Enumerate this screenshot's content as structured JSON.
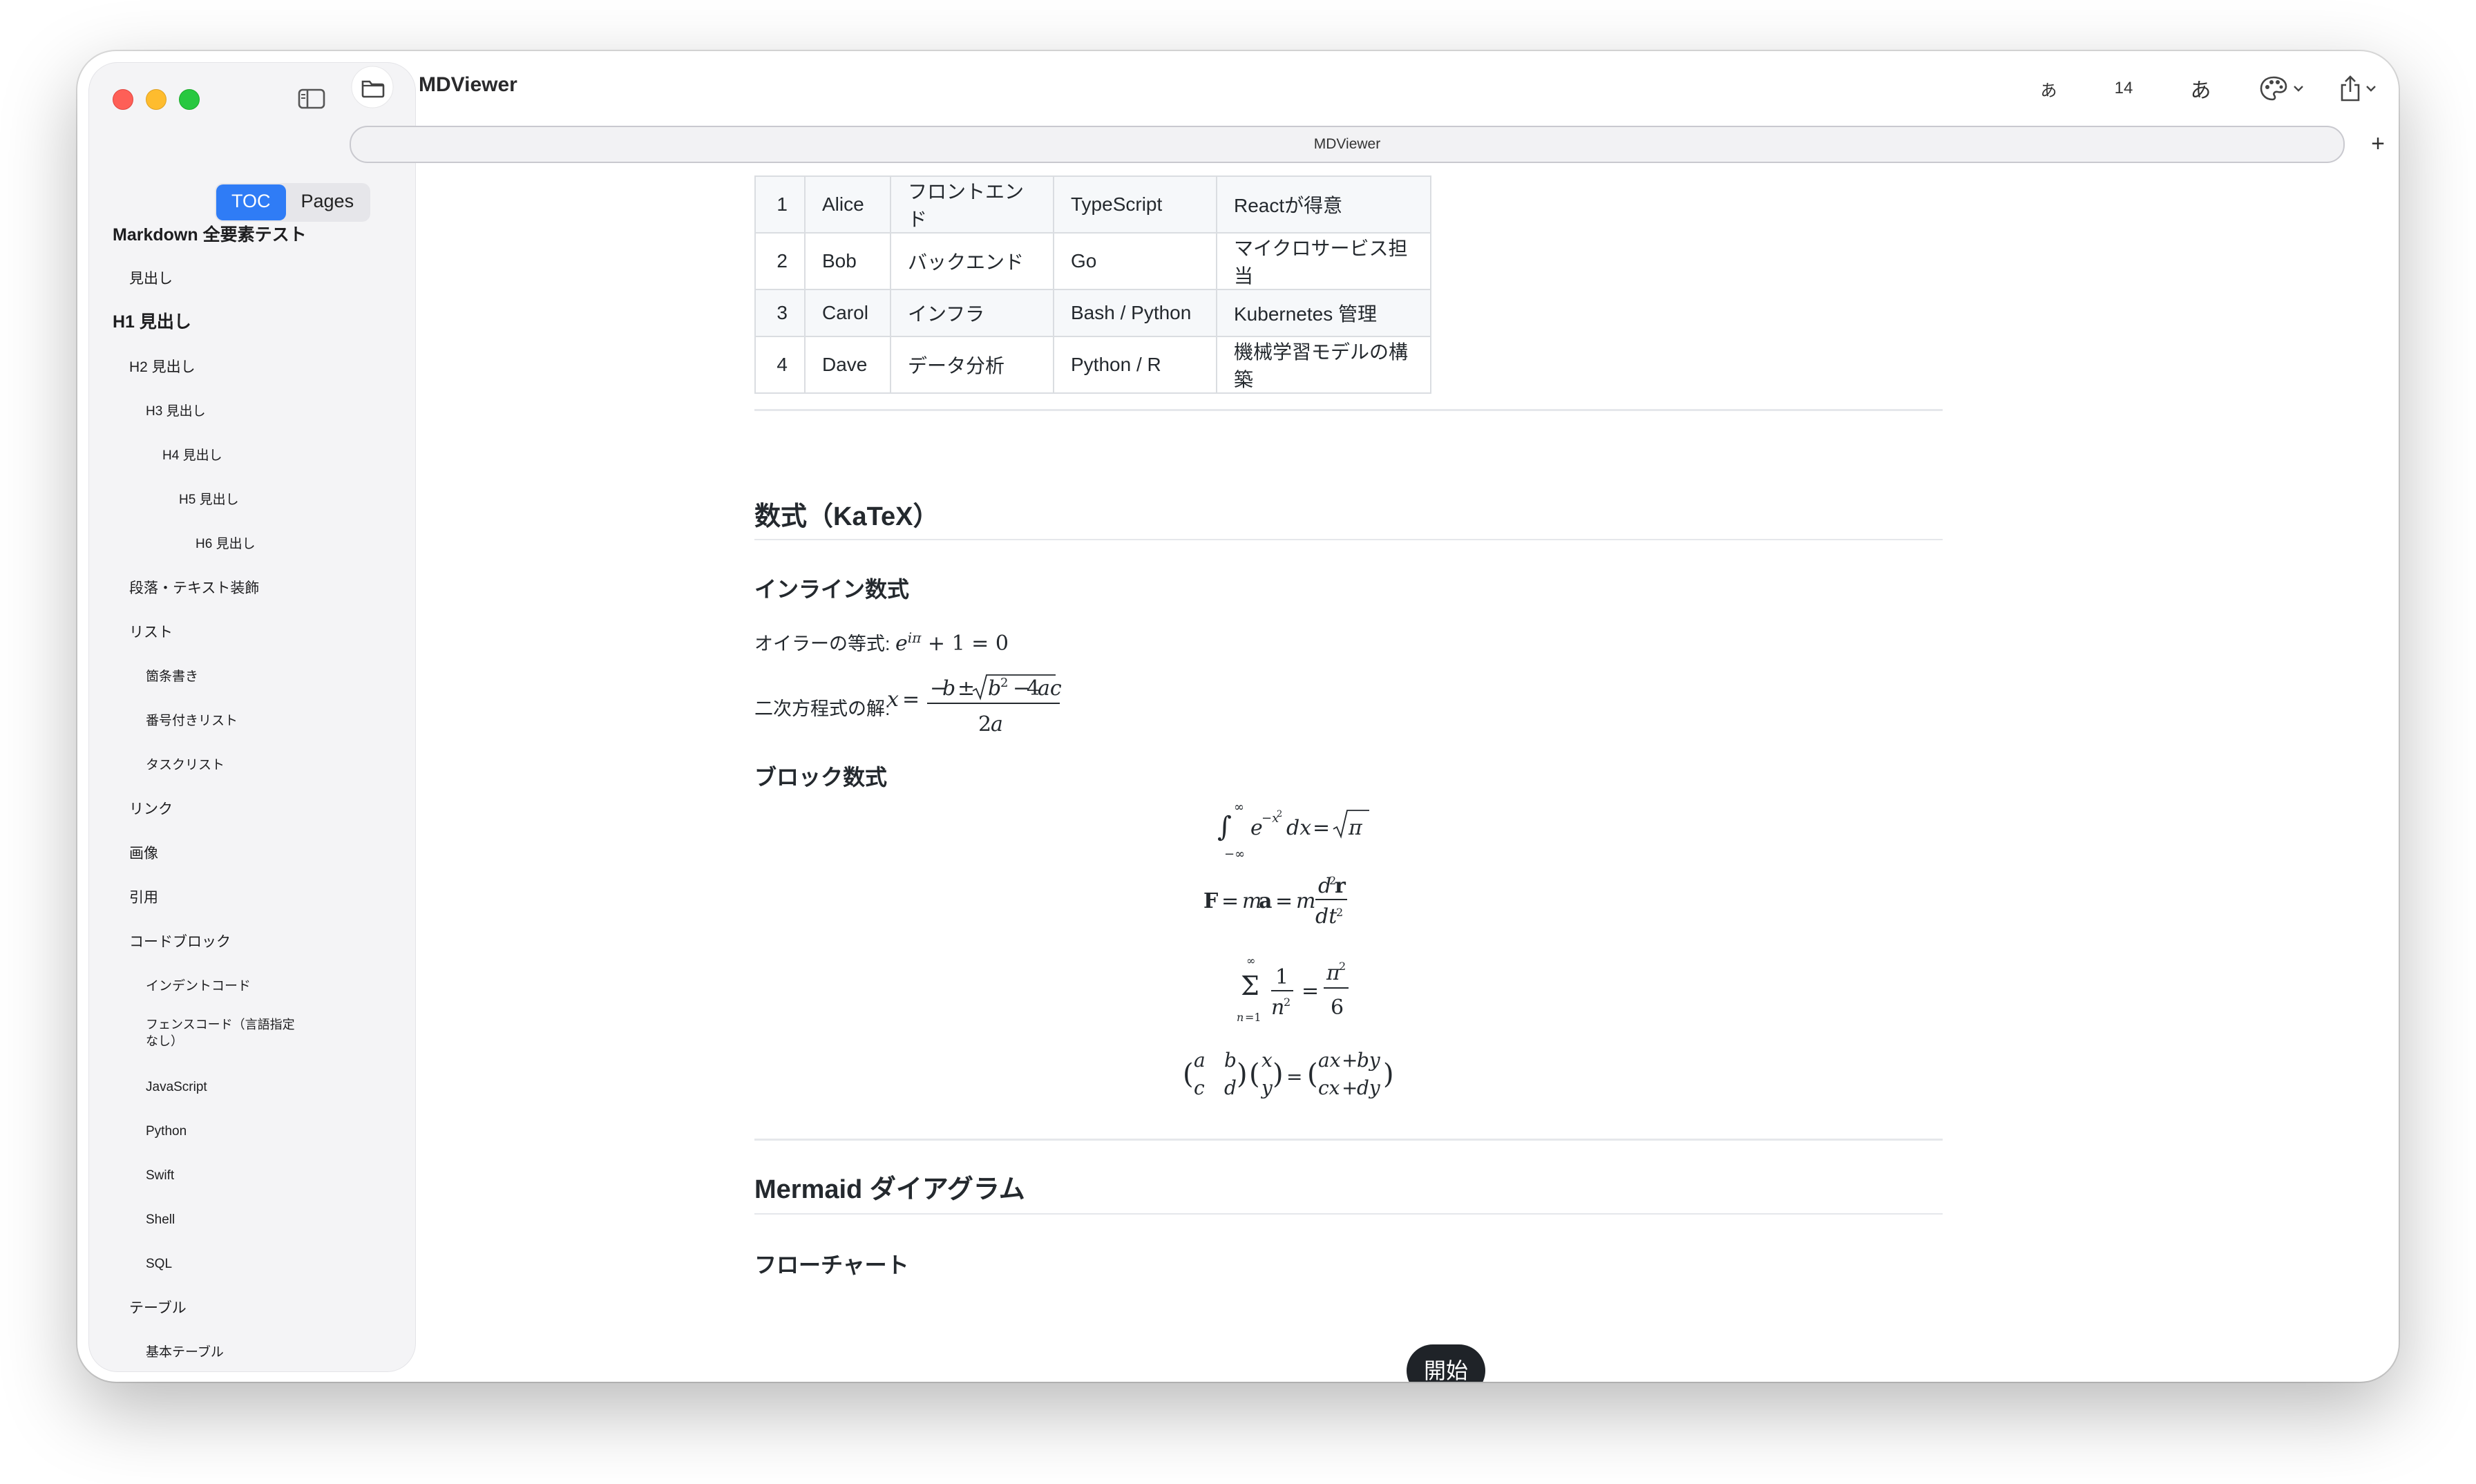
{
  "app": {
    "title": "MDViewer",
    "tab_title": "MDViewer"
  },
  "toolbar": {
    "font_small": "あ",
    "font_size": "14",
    "font_large": "あ",
    "theme_icon": "palette-icon",
    "share_icon": "share-icon",
    "new_tab": "+"
  },
  "sidebar": {
    "segments": [
      "TOC",
      "Pages"
    ],
    "active_segment": "TOC",
    "toc": [
      {
        "label": "Markdown 全要素テスト",
        "level": 1
      },
      {
        "label": "見出し",
        "level": 2
      },
      {
        "label": "H1 見出し",
        "level": 1
      },
      {
        "label": "H2 見出し",
        "level": 2
      },
      {
        "label": "H3 見出し",
        "level": 3
      },
      {
        "label": "H4 見出し",
        "level": 4
      },
      {
        "label": "H5 見出し",
        "level": 5
      },
      {
        "label": "H6 見出し",
        "level": 6
      },
      {
        "label": "段落・テキスト装飾",
        "level": 2
      },
      {
        "label": "リスト",
        "level": 2
      },
      {
        "label": "箇条書き",
        "level": 3
      },
      {
        "label": "番号付きリスト",
        "level": 3
      },
      {
        "label": "タスクリスト",
        "level": 3
      },
      {
        "label": "リンク",
        "level": 2
      },
      {
        "label": "画像",
        "level": 2
      },
      {
        "label": "引用",
        "level": 2
      },
      {
        "label": "コードブロック",
        "level": 2
      },
      {
        "label": "インデントコード",
        "level": 3
      },
      {
        "label": "フェンスコード（言語指定なし）",
        "level": 3
      },
      {
        "label": "JavaScript",
        "level": 3
      },
      {
        "label": "Python",
        "level": 3
      },
      {
        "label": "Swift",
        "level": 3
      },
      {
        "label": "Shell",
        "level": 3
      },
      {
        "label": "SQL",
        "level": 3
      },
      {
        "label": "テーブル",
        "level": 2
      },
      {
        "label": "基本テーブル",
        "level": 3
      }
    ]
  },
  "content": {
    "table_rows": [
      [
        "1",
        "Alice",
        "フロントエンド",
        "TypeScript",
        "Reactが得意"
      ],
      [
        "2",
        "Bob",
        "バックエンド",
        "Go",
        "マイクロサービス担当"
      ],
      [
        "3",
        "Carol",
        "インフラ",
        "Bash / Python",
        "Kubernetes 管理"
      ],
      [
        "4",
        "Dave",
        "データ分析",
        "Python / R",
        "機械学習モデルの構築"
      ]
    ],
    "math_section_title": "数式（KaTeX）",
    "inline_math_title": "インライン数式",
    "euler_label": "オイラーの等式:",
    "quadratic_label": "二次方程式の解:",
    "block_math_title": "ブロック数式",
    "mermaid_section_title": "Mermaid ダイアグラム",
    "flowchart_title": "フローチャート",
    "flow_start_node": "開始"
  }
}
